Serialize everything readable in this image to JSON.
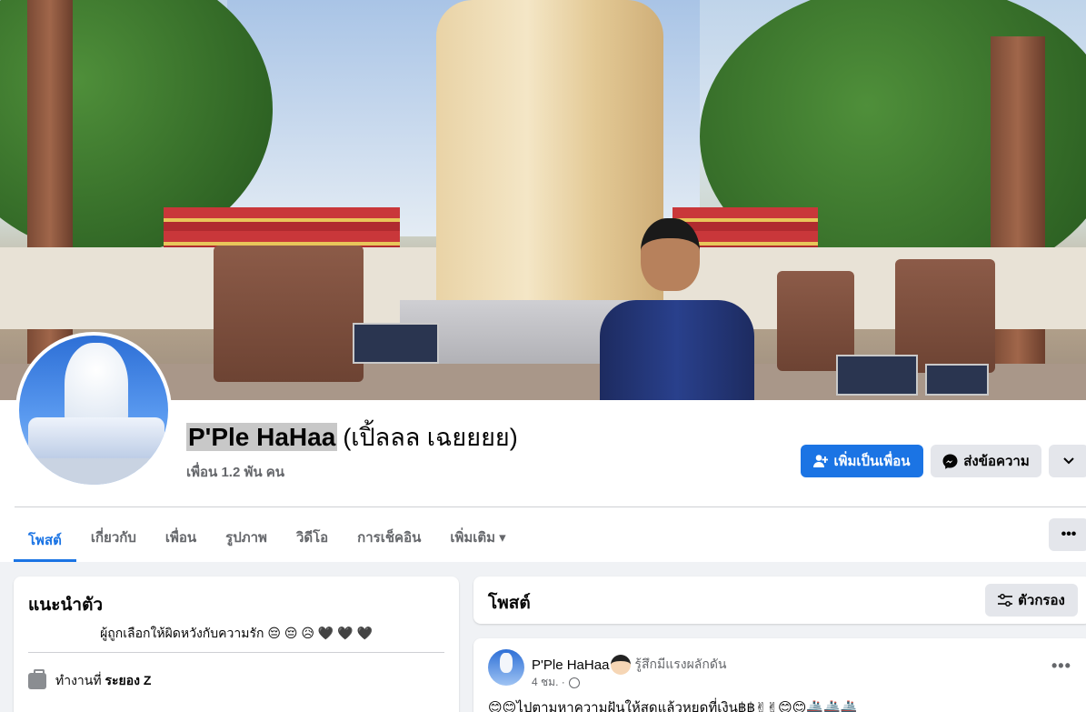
{
  "profile": {
    "name": "P'Ple HaHaa",
    "alt_name": "(เปิ้ลลล เฉยยยย)",
    "friends": "เพื่อน 1.2 พัน คน"
  },
  "actions": {
    "add_friend": "เพิ่มเป็นเพื่อน",
    "message": "ส่งข้อความ"
  },
  "tabs": [
    {
      "label": "โพสต์",
      "active": true
    },
    {
      "label": "เกี่ยวกับ"
    },
    {
      "label": "เพื่อน"
    },
    {
      "label": "รูปภาพ"
    },
    {
      "label": "วิดีโอ"
    },
    {
      "label": "การเช็คอิน"
    },
    {
      "label": "เพิ่มเติม ▾"
    }
  ],
  "more_menu": "•••",
  "intro": {
    "title": "แนะนำตัว",
    "bio": "ผู้ถูกเลือกให้ผิดหวังกับความรัก 😔 😔 😥 🖤 🖤 🖤",
    "work_prefix": "ทำงานที่ ",
    "work_place": "ระยอง Z"
  },
  "posts": {
    "title": "โพสต์",
    "filter": "ตัวกรอง",
    "items": [
      {
        "author": "P'Ple HaHaa",
        "feeling": "รู้สึกมีแรงผลักดัน",
        "time": "4 ชม. ·",
        "text": "😊😊ไปตามหาความฝันให้สุดแล้วหยุดที่เงิน฿฿✌✌😊😊🚢🚢🚢"
      }
    ],
    "dots": "•••"
  },
  "colors": {
    "accent": "#1b74e4",
    "page_bg": "#f0f2f5"
  }
}
